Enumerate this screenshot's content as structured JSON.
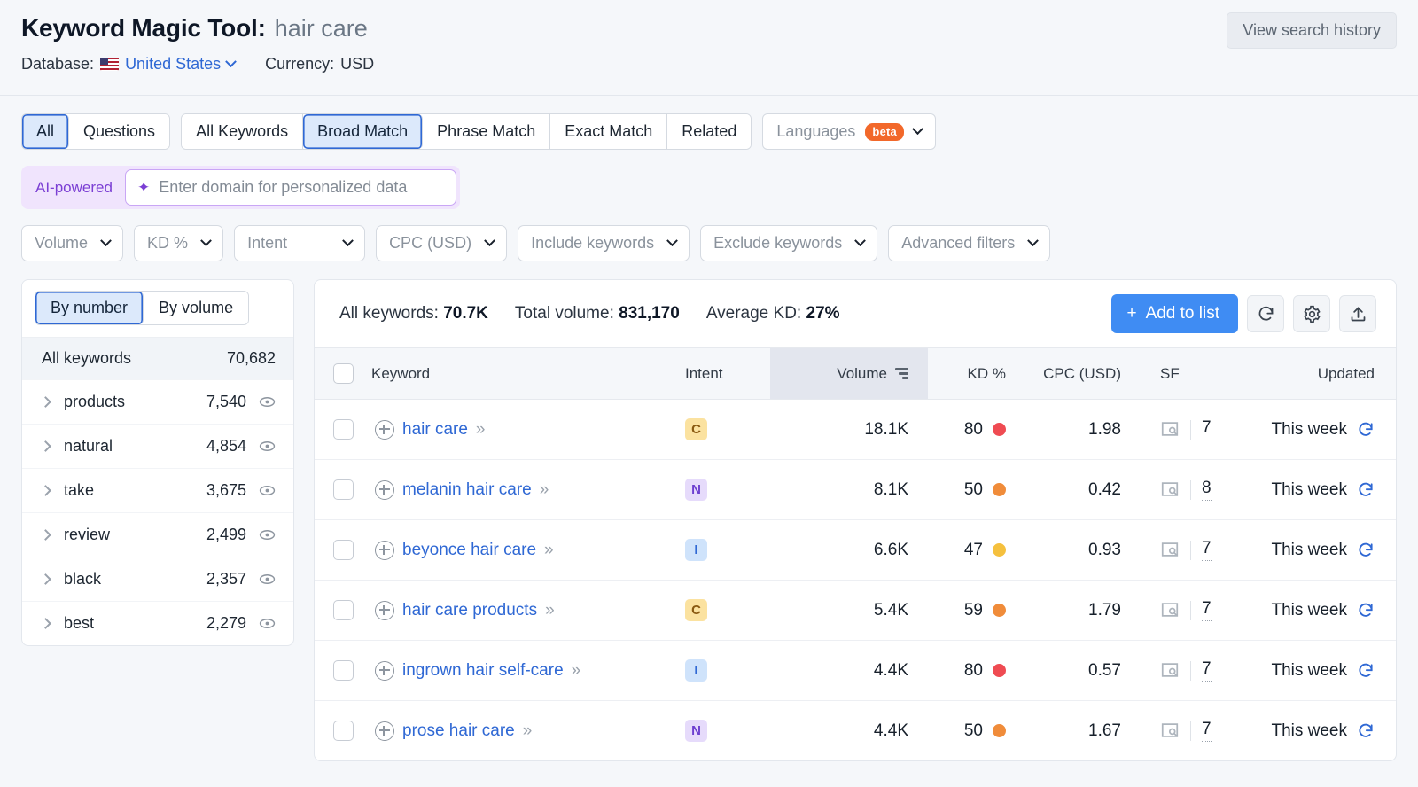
{
  "header": {
    "title_main": "Keyword Magic Tool:",
    "query": "hair care",
    "database_label": "Database:",
    "database_value": "United States",
    "currency_label": "Currency:",
    "currency_value": "USD",
    "history_button": "View search history",
    "flag_icon": "us-flag-icon"
  },
  "tabs": {
    "group_a": [
      {
        "label": "All",
        "active": true
      },
      {
        "label": "Questions",
        "active": false
      }
    ],
    "group_b": [
      {
        "label": "All Keywords",
        "active": false
      },
      {
        "label": "Broad Match",
        "active": true
      },
      {
        "label": "Phrase Match",
        "active": false
      },
      {
        "label": "Exact Match",
        "active": false
      },
      {
        "label": "Related",
        "active": false
      }
    ],
    "languages": {
      "label": "Languages",
      "badge": "beta"
    }
  },
  "ai_bar": {
    "tag": "AI-powered",
    "placeholder": "Enter domain for personalized data",
    "value": "",
    "accent": "#7b3fd4"
  },
  "filters": [
    "Volume",
    "KD %",
    "Intent",
    "CPC (USD)",
    "Include keywords",
    "Exclude keywords",
    "Advanced filters"
  ],
  "sidebar": {
    "toggle": [
      {
        "label": "By number",
        "active": true
      },
      {
        "label": "By volume",
        "active": false
      }
    ],
    "all_keywords": {
      "label": "All keywords",
      "count": "70,682"
    },
    "items": [
      {
        "label": "products",
        "count": "7,540"
      },
      {
        "label": "natural",
        "count": "4,854"
      },
      {
        "label": "take",
        "count": "3,675"
      },
      {
        "label": "review",
        "count": "2,499"
      },
      {
        "label": "black",
        "count": "2,357"
      },
      {
        "label": "best",
        "count": "2,279"
      }
    ]
  },
  "summary": {
    "all_keywords_label": "All keywords:",
    "all_keywords_value": "70.7K",
    "total_volume_label": "Total volume:",
    "total_volume_value": "831,170",
    "average_kd_label": "Average KD:",
    "average_kd_value": "27%"
  },
  "actions": {
    "add_to_list": "Add to list",
    "add_icon": "plus-icon",
    "refresh_icon": "refresh-icon",
    "settings_icon": "gear-icon",
    "export_icon": "export-icon"
  },
  "table": {
    "columns": [
      "Keyword",
      "Intent",
      "Volume",
      "KD %",
      "CPC (USD)",
      "SF",
      "Updated"
    ],
    "sorted_column": "Volume",
    "sort_icon": "sort-descending-icon",
    "rows": [
      {
        "keyword": "hair care",
        "intent": "C",
        "volume": "18.1K",
        "kd": "80",
        "kd_color": "#ef4b52",
        "cpc": "1.98",
        "sf": "7",
        "updated": "This week"
      },
      {
        "keyword": "melanin hair care",
        "intent": "N",
        "volume": "8.1K",
        "kd": "50",
        "kd_color": "#f08c3a",
        "cpc": "0.42",
        "sf": "8",
        "updated": "This week"
      },
      {
        "keyword": "beyonce hair care",
        "intent": "I",
        "volume": "6.6K",
        "kd": "47",
        "kd_color": "#f5c03e",
        "cpc": "0.93",
        "sf": "7",
        "updated": "This week"
      },
      {
        "keyword": "hair care products",
        "intent": "C",
        "volume": "5.4K",
        "kd": "59",
        "kd_color": "#f08c3a",
        "cpc": "1.79",
        "sf": "7",
        "updated": "This week"
      },
      {
        "keyword": "ingrown hair self-care",
        "intent": "I",
        "volume": "4.4K",
        "kd": "80",
        "kd_color": "#ef4b52",
        "cpc": "0.57",
        "sf": "7",
        "updated": "This week"
      },
      {
        "keyword": "prose hair care",
        "intent": "N",
        "volume": "4.4K",
        "kd": "50",
        "kd_color": "#f08c3a",
        "cpc": "1.67",
        "sf": "7",
        "updated": "This week"
      }
    ],
    "intent_styles": {
      "C": {
        "bg": "#fbe2a0",
        "fg": "#8a5a12"
      },
      "N": {
        "bg": "#e6dbfb",
        "fg": "#6d3fd0"
      },
      "I": {
        "bg": "#cfe3fb",
        "fg": "#2f68d4"
      }
    }
  },
  "colors": {
    "accent_blue": "#3f8cf3",
    "link_blue": "#2f68d4",
    "beta_orange": "#f2682a"
  }
}
